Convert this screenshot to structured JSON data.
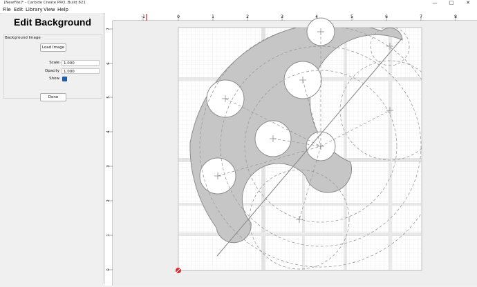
{
  "window": {
    "title": "[NewFile]* - Carbide Create PRO, Build 821",
    "controls": {
      "minimize": "—",
      "maximize": "□",
      "close": "✕"
    }
  },
  "menu": {
    "items": [
      {
        "label": "File"
      },
      {
        "label": "Edit"
      },
      {
        "label": "Library"
      },
      {
        "label": "View"
      },
      {
        "label": "Help"
      }
    ]
  },
  "panel": {
    "title": "Edit Background",
    "group_label": "Background Image",
    "load_button": "Load Image",
    "scale_label": "Scale",
    "scale_value": "1.000",
    "opacity_label": "Opacity",
    "opacity_value": "1.000",
    "show_label": "Show",
    "show_checked": true,
    "done_button": "Done"
  },
  "ruler": {
    "top_labels": [
      "-1",
      "0",
      "1",
      "2",
      "3",
      "4",
      "5",
      "6",
      "7",
      "8"
    ],
    "left_labels": [
      "7",
      "6",
      "5",
      "4",
      "3",
      "2",
      "1",
      "0"
    ]
  },
  "colors": {
    "canvas_bg": "#eeeeee",
    "shape_fill": "#c8c8c8",
    "accent_red": "#e0282d",
    "checkbox_blue": "#1f5fbf"
  }
}
